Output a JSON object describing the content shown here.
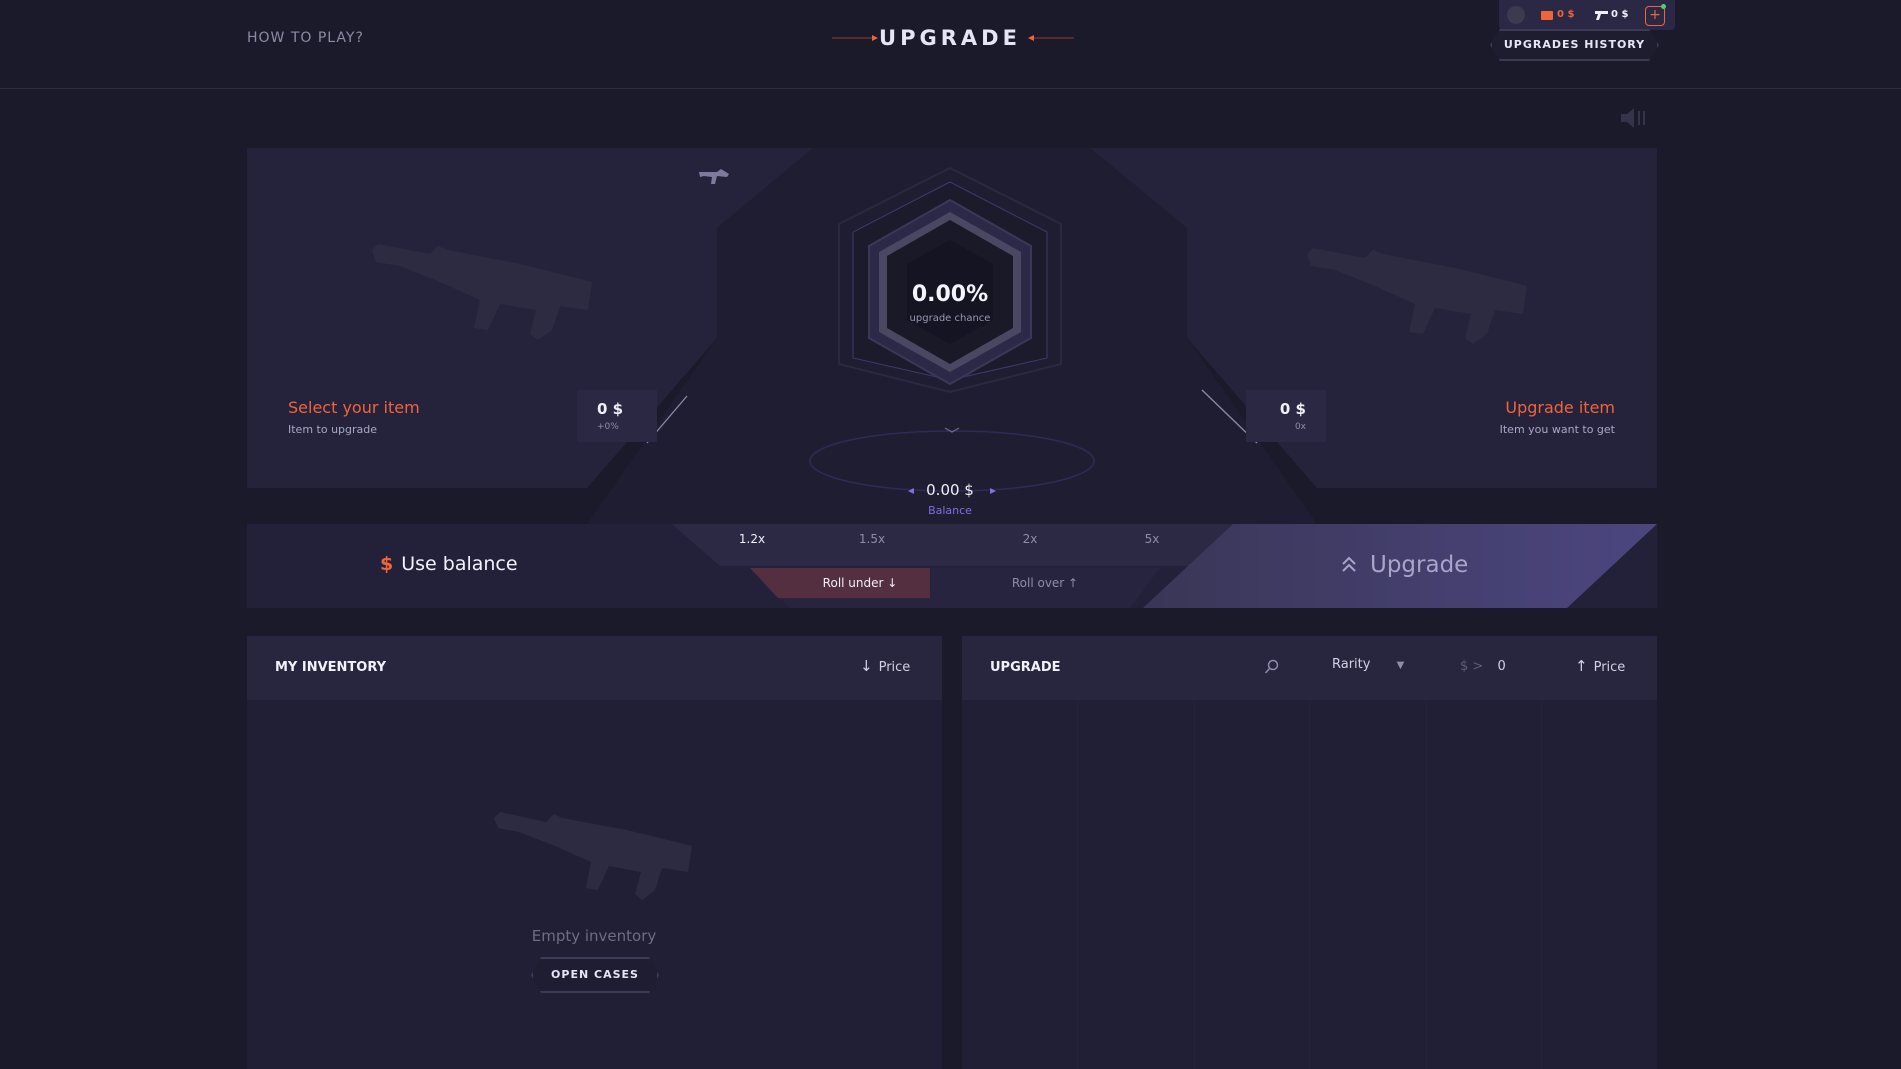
{
  "header": {
    "how_to_play": "HOW TO PLAY?",
    "title": "UPGRADE",
    "upgrades_history": "UPGRADES HISTORY",
    "user": {
      "cash": "0 $",
      "gun_balance": "0 $"
    }
  },
  "arena": {
    "left_slot": {
      "title": "Select your item",
      "subtitle": "Item to upgrade",
      "price": "0 $",
      "bonus": "+0%"
    },
    "right_slot": {
      "title": "Upgrade item",
      "subtitle": "Item you want to get",
      "price": "0 $",
      "multiplier": "0x"
    },
    "chance": {
      "value": "0.00%",
      "label": "upgrade chance"
    },
    "balance": {
      "value": "0.00 $",
      "label": "Balance"
    }
  },
  "controls": {
    "use_balance": "Use balance",
    "currency_symbol": "$",
    "multipliers": [
      "1.2x",
      "1.5x",
      "2x",
      "5x"
    ],
    "roll_under": "Roll under ↓",
    "roll_over": "Roll over ↑",
    "upgrade_button": "Upgrade"
  },
  "inventory": {
    "title": "MY INVENTORY",
    "sort_label": "Price",
    "empty_text": "Empty inventory",
    "open_cases": "OPEN CASES"
  },
  "upgrade_list": {
    "title": "UPGRADE",
    "rarity_label": "Rarity",
    "price_filter_prefix": "$ >",
    "price_filter_value": "0",
    "sort_label": "Price"
  },
  "colors": {
    "background": "#1b1a2a",
    "panel": "#23213a",
    "accent_orange": "#f0643a",
    "accent_purple": "#7e6fe6"
  }
}
